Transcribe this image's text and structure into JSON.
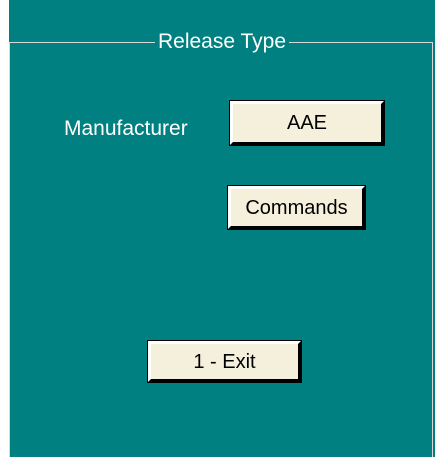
{
  "groupbox": {
    "title": "Release Type"
  },
  "form": {
    "manufacturer_label": "Manufacturer",
    "manufacturer_button": "AAE",
    "commands_button": "Commands",
    "exit_button": "1 - Exit"
  },
  "colors": {
    "background": "#008080",
    "button_face": "#f5f0dc",
    "text_on_background": "#ffffff"
  }
}
